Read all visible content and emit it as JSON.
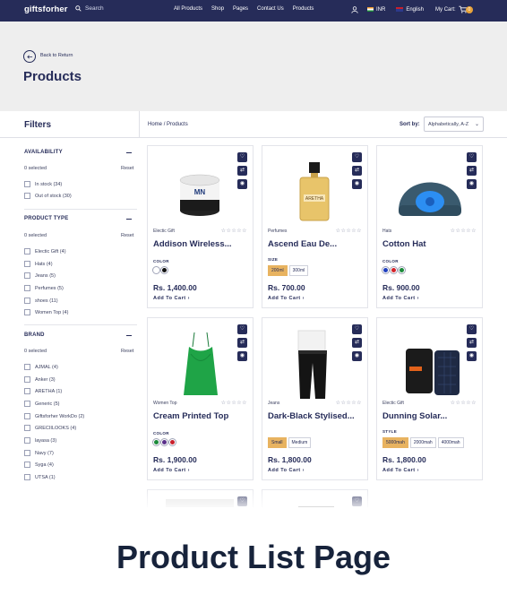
{
  "nav": {
    "logo": "giftsforher",
    "search": "Search",
    "links": [
      "All Products",
      "Shop",
      "Pages",
      "Contact Us",
      "Products"
    ],
    "currency": "INR",
    "language": "English",
    "cart_label": "My Cart",
    "cart_count": "0"
  },
  "hero": {
    "back": "Back to Return",
    "title": "Products"
  },
  "filters": {
    "title": "Filters",
    "availability": {
      "title": "AVAILABILITY",
      "selected": "0 selected",
      "reset": "Reset",
      "options": [
        "In stock (34)",
        "Out of stock (30)"
      ]
    },
    "product_type": {
      "title": "PRODUCT TYPE",
      "selected": "0 selected",
      "reset": "Reset",
      "options": [
        "Electic Gift (4)",
        "Hats (4)",
        "Jeans (5)",
        "Perfumes (5)",
        "shoes (11)",
        "Women Top (4)"
      ]
    },
    "brand": {
      "title": "BRAND",
      "selected": "0 selected",
      "reset": "Reset",
      "options": [
        "AJMAL (4)",
        "Anker (3)",
        "ARETHA (1)",
        "Generic (5)",
        "Giftsforher WorkDo (2)",
        "GRECIILOOKS (4)",
        "layasa (3)",
        "Navy (7)",
        "Syga (4)",
        "UTSA (1)"
      ]
    }
  },
  "breadcrumb": {
    "home": "Home",
    "sep": "/",
    "current": "Products"
  },
  "sort": {
    "label": "Sort by:",
    "value": "Alphabetically, A-Z"
  },
  "products": [
    {
      "category": "Electic Gift",
      "name": "Addison Wireless...",
      "option_label": "COLOR",
      "colors": [
        "#ffffff",
        "#111111"
      ],
      "price": "Rs. 1,400.00",
      "add": "Add To Cart"
    },
    {
      "category": "Perfumes",
      "name": "Ascend Eau De...",
      "option_label": "SIZE",
      "sizes": [
        "200ml",
        "300ml"
      ],
      "price": "Rs. 700.00",
      "add": "Add To Cart"
    },
    {
      "category": "Hats",
      "name": "Cotton Hat",
      "option_label": "COLOR",
      "colors": [
        "#1f3fbf",
        "#d4232a",
        "#1b8a3a"
      ],
      "price": "Rs. 900.00",
      "add": "Add To Cart"
    },
    {
      "category": "Women Top",
      "name": "Cream Printed Top",
      "option_label": "COLOR",
      "colors": [
        "#1b8a3a",
        "#5a2f8a",
        "#c8202c"
      ],
      "price": "Rs. 1,900.00",
      "add": "Add To Cart"
    },
    {
      "category": "Jeans",
      "name": "Dark-Black Stylised...",
      "option_label": "SIZE",
      "sizes": [
        "Small",
        "Medium"
      ],
      "price": "Rs. 1,800.00",
      "add": "Add To Cart"
    },
    {
      "category": "Electic Gift",
      "name": "Dunning Solar...",
      "option_label": "STYLE",
      "sizes": [
        "5000mah",
        "2000mah",
        "4000mah"
      ],
      "price": "Rs. 1,800.00",
      "add": "Add To Cart"
    }
  ],
  "caption": "Product List Page"
}
